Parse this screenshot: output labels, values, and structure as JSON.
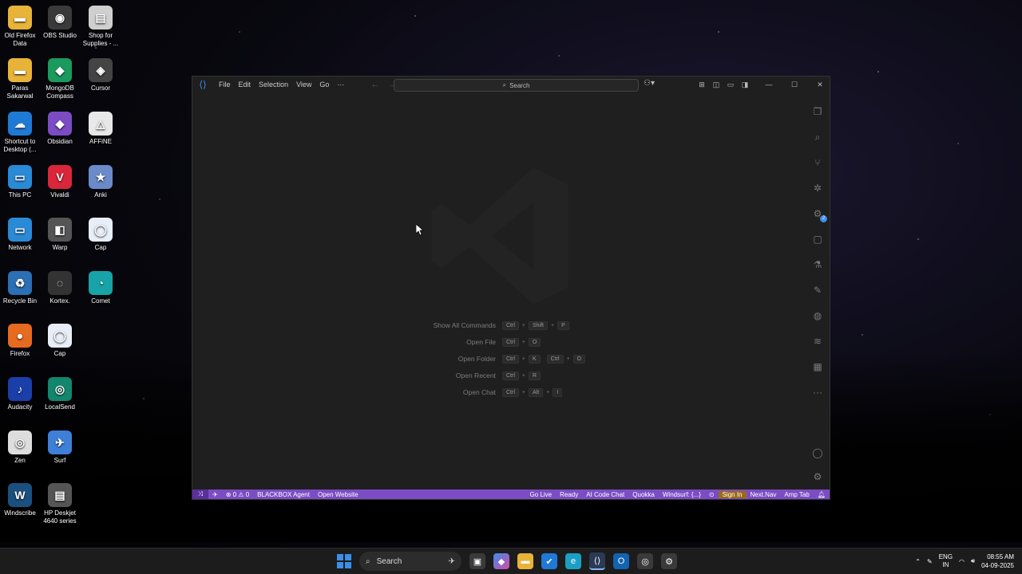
{
  "desktop": {
    "icons": [
      {
        "label": "Old Firefox Data",
        "glyph": "▬",
        "color": "#e8b339"
      },
      {
        "label": "OBS Studio",
        "glyph": "◉",
        "color": "#3a3a3a"
      },
      {
        "label": "Shop for Supplies - ...",
        "glyph": "▤",
        "color": "#cfcfcf"
      },
      {
        "label": "Paras Sakarwal",
        "glyph": "▬",
        "color": "#e8b339"
      },
      {
        "label": "MongoDB Compass",
        "glyph": "◆",
        "color": "#1b9a5e"
      },
      {
        "label": "Cursor",
        "glyph": "◈",
        "color": "#444"
      },
      {
        "label": "Shortcut to Desktop (...",
        "glyph": "☁",
        "color": "#1f7ad6"
      },
      {
        "label": "Obsidian",
        "glyph": "◆",
        "color": "#7b4cc4"
      },
      {
        "label": "AFFiNE",
        "glyph": "△",
        "color": "#e8e8e8"
      },
      {
        "label": "This PC",
        "glyph": "▭",
        "color": "#2a8ad6"
      },
      {
        "label": "Vivaldi",
        "glyph": "V",
        "color": "#d9263a"
      },
      {
        "label": "Anki",
        "glyph": "★",
        "color": "#6b8ac9"
      },
      {
        "label": "Network",
        "glyph": "▭",
        "color": "#2a8ad6"
      },
      {
        "label": "Warp",
        "glyph": "◧",
        "color": "#555"
      },
      {
        "label": "Cap",
        "glyph": "◯",
        "color": "#e8eef8"
      },
      {
        "label": "Recycle Bin",
        "glyph": "♻",
        "color": "#2b6fb5"
      },
      {
        "label": "Kortex.",
        "glyph": "◌",
        "color": "#333"
      },
      {
        "label": "Comet",
        "glyph": "◔",
        "color": "#18a3a8"
      },
      {
        "label": "Firefox",
        "glyph": "●",
        "color": "#e66a1f"
      },
      {
        "label": "Cap",
        "glyph": "◯",
        "color": "#e8eef8"
      },
      {
        "label": "Audacity",
        "glyph": "♪",
        "color": "#1b3fa8"
      },
      {
        "label": "LocalSend",
        "glyph": "◎",
        "color": "#13866e"
      },
      {
        "label": "Zen",
        "glyph": "◎",
        "color": "#ddd"
      },
      {
        "label": "Surf",
        "glyph": "✈",
        "color": "#3e7fd8"
      },
      {
        "label": "Windscribe",
        "glyph": "W",
        "color": "#1a5080"
      },
      {
        "label": "HP Deskjet 4640 series",
        "glyph": "▤",
        "color": "#555"
      }
    ]
  },
  "vscode": {
    "menu": [
      "File",
      "Edit",
      "Selection",
      "View",
      "Go",
      "···"
    ],
    "search_placeholder": "Search",
    "shortcuts": [
      {
        "label": "Show All Commands",
        "keys": [
          [
            "Ctrl",
            "Shift",
            "P"
          ]
        ]
      },
      {
        "label": "Open File",
        "keys": [
          [
            "Ctrl",
            "O"
          ]
        ]
      },
      {
        "label": "Open Folder",
        "keys": [
          [
            "Ctrl",
            "K"
          ],
          [
            "Ctrl",
            "O"
          ]
        ]
      },
      {
        "label": "Open Recent",
        "keys": [
          [
            "Ctrl",
            "R"
          ]
        ]
      },
      {
        "label": "Open Chat",
        "keys": [
          [
            "Ctrl",
            "Alt",
            "I"
          ]
        ]
      }
    ],
    "activity_badge": "2",
    "status": {
      "problems": "⊗ 0 ⚠ 0",
      "blackbox": "BLACKBOX Agent",
      "open_website": "Open Website",
      "go_live": "Go Live",
      "ready": "Ready",
      "ai_code_chat": "AI Code Chat",
      "quokka": "Quokka",
      "windsurf": "Windsurf: {...}",
      "sign_in": "Sign In",
      "next_nav": "Next.Nav",
      "amp_tab": "Amp Tab"
    }
  },
  "taskbar": {
    "search": "Search",
    "lang_top": "ENG",
    "lang_bottom": "IN",
    "time": "08:55 AM",
    "date": "04-09-2025"
  }
}
